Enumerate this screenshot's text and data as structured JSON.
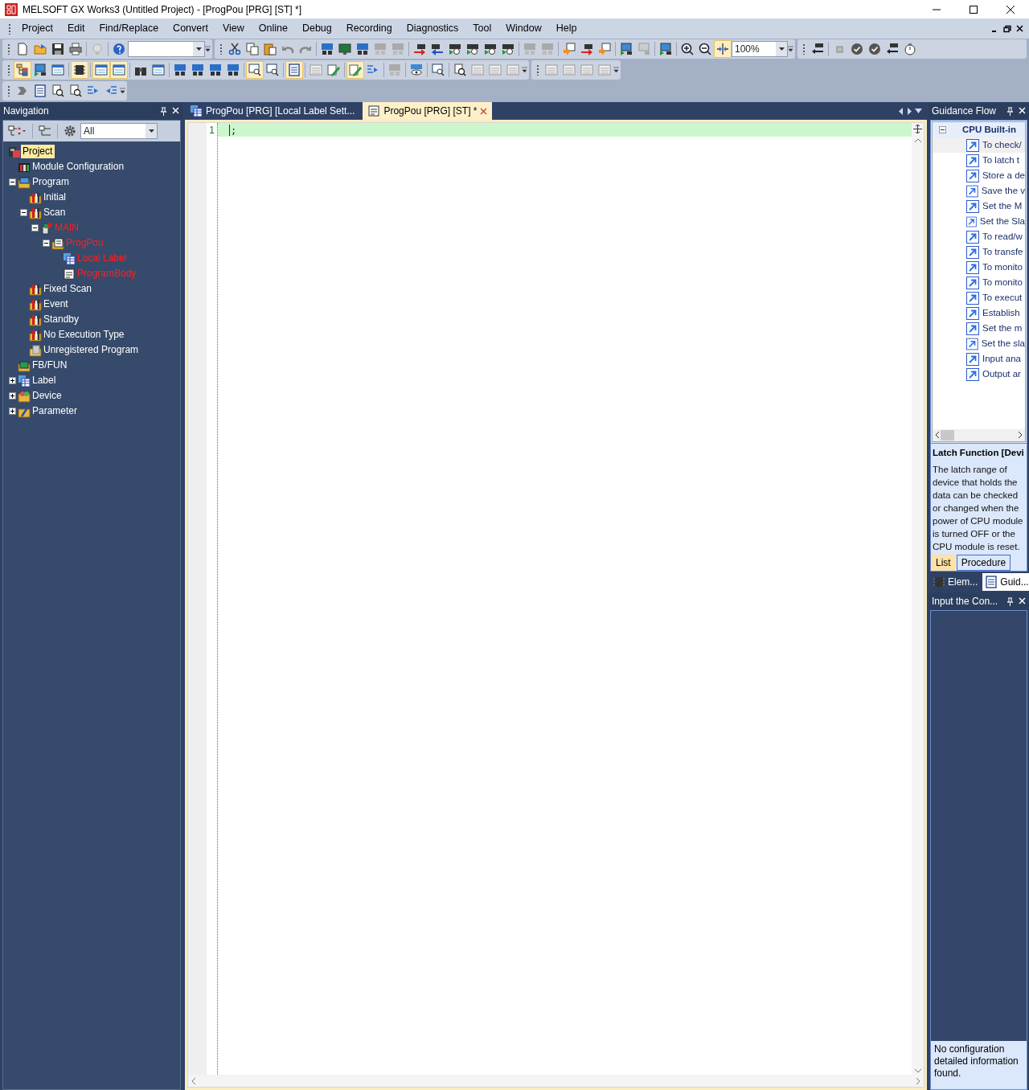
{
  "window": {
    "title": "MELSOFT GX Works3 (Untitled Project) - [ProgPou [PRG] [ST] *]"
  },
  "menu": [
    "Project",
    "Edit",
    "Find/Replace",
    "Convert",
    "View",
    "Online",
    "Debug",
    "Recording",
    "Diagnostics",
    "Tool",
    "Window",
    "Help"
  ],
  "toolbar": {
    "zoom": "100%"
  },
  "navigation": {
    "title": "Navigation",
    "filter": "All",
    "tree": [
      {
        "label": "Project",
        "kind": "project",
        "selected": true,
        "modified": false,
        "children": [
          {
            "label": "Module Configuration",
            "kind": "module",
            "selected": false,
            "modified": false
          },
          {
            "label": "Program",
            "kind": "program",
            "expanded": true,
            "selected": false,
            "modified": false,
            "children": [
              {
                "label": "Initial",
                "kind": "task",
                "selected": false,
                "modified": false
              },
              {
                "label": "Scan",
                "kind": "task",
                "expanded": true,
                "selected": false,
                "modified": false,
                "children": [
                  {
                    "label": "MAIN",
                    "kind": "program-file",
                    "expanded": true,
                    "selected": false,
                    "modified": true,
                    "children": [
                      {
                        "label": "ProgPou",
                        "kind": "st-pou",
                        "expanded": true,
                        "selected": false,
                        "modified": true,
                        "children": [
                          {
                            "label": "Local Label",
                            "kind": "label-table",
                            "selected": false,
                            "modified": true
                          },
                          {
                            "label": "ProgramBody",
                            "kind": "st-body",
                            "selected": false,
                            "modified": true
                          }
                        ]
                      }
                    ]
                  }
                ]
              },
              {
                "label": "Fixed Scan",
                "kind": "task",
                "selected": false,
                "modified": false
              },
              {
                "label": "Event",
                "kind": "task",
                "selected": false,
                "modified": false
              },
              {
                "label": "Standby",
                "kind": "task",
                "selected": false,
                "modified": false
              },
              {
                "label": "No Execution Type",
                "kind": "task",
                "selected": false,
                "modified": false
              },
              {
                "label": "Unregistered Program",
                "kind": "unregistered",
                "selected": false,
                "modified": false
              }
            ]
          },
          {
            "label": "FB/FUN",
            "kind": "fbfun",
            "selected": false,
            "modified": false
          },
          {
            "label": "Label",
            "kind": "label-table",
            "expanded": false,
            "selected": false,
            "modified": false
          },
          {
            "label": "Device",
            "kind": "device",
            "expanded": false,
            "selected": false,
            "modified": false
          },
          {
            "label": "Parameter",
            "kind": "parameter",
            "expanded": false,
            "selected": false,
            "modified": false
          }
        ]
      }
    ]
  },
  "tabs": [
    {
      "label": "ProgPou [PRG] [Local Label Sett...",
      "kind": "label-table",
      "selected": false
    },
    {
      "label": "ProgPou [PRG] [ST] *",
      "kind": "st-body",
      "selected": true
    }
  ],
  "editor": {
    "lines": [
      {
        "number": "1",
        "text": ";",
        "current": true
      }
    ]
  },
  "guidance": {
    "title": "Guidance Flow",
    "category": "CPU Built-in",
    "expanded": true,
    "items": [
      {
        "label": "To check/",
        "selected": true
      },
      {
        "label": "To latch t",
        "selected": false
      },
      {
        "label": "Store a de",
        "selected": false
      },
      {
        "label": "Save the v",
        "selected": false
      },
      {
        "label": "Set the M",
        "selected": false
      },
      {
        "label": "Set the Sla",
        "selected": false
      },
      {
        "label": "To read/w",
        "selected": false
      },
      {
        "label": "To transfe",
        "selected": false
      },
      {
        "label": "To monito",
        "selected": false
      },
      {
        "label": "To monito",
        "selected": false
      },
      {
        "label": "To execut",
        "selected": false
      },
      {
        "label": "Establish",
        "selected": false
      },
      {
        "label": "Set the m",
        "selected": false
      },
      {
        "label": "Set the sla",
        "selected": false
      },
      {
        "label": "Input ana",
        "selected": false
      },
      {
        "label": "Output ar",
        "selected": false
      }
    ],
    "detail_title": "Latch Function [Devi",
    "detail_text": "The latch range of device that holds the data can be checked or changed when the power of CPU module is turned OFF or the CPU module is reset.",
    "tabs": [
      {
        "label": "List",
        "selected": true
      },
      {
        "label": "Procedure",
        "selected": false
      }
    ]
  },
  "dock_tabs": [
    {
      "label": "Elem...",
      "kind": "element",
      "selected": false
    },
    {
      "label": "Guid...",
      "kind": "guidance",
      "selected": true
    }
  ],
  "config_panel": {
    "title": "Input the Con...",
    "message": "No configuration detailed information found."
  }
}
